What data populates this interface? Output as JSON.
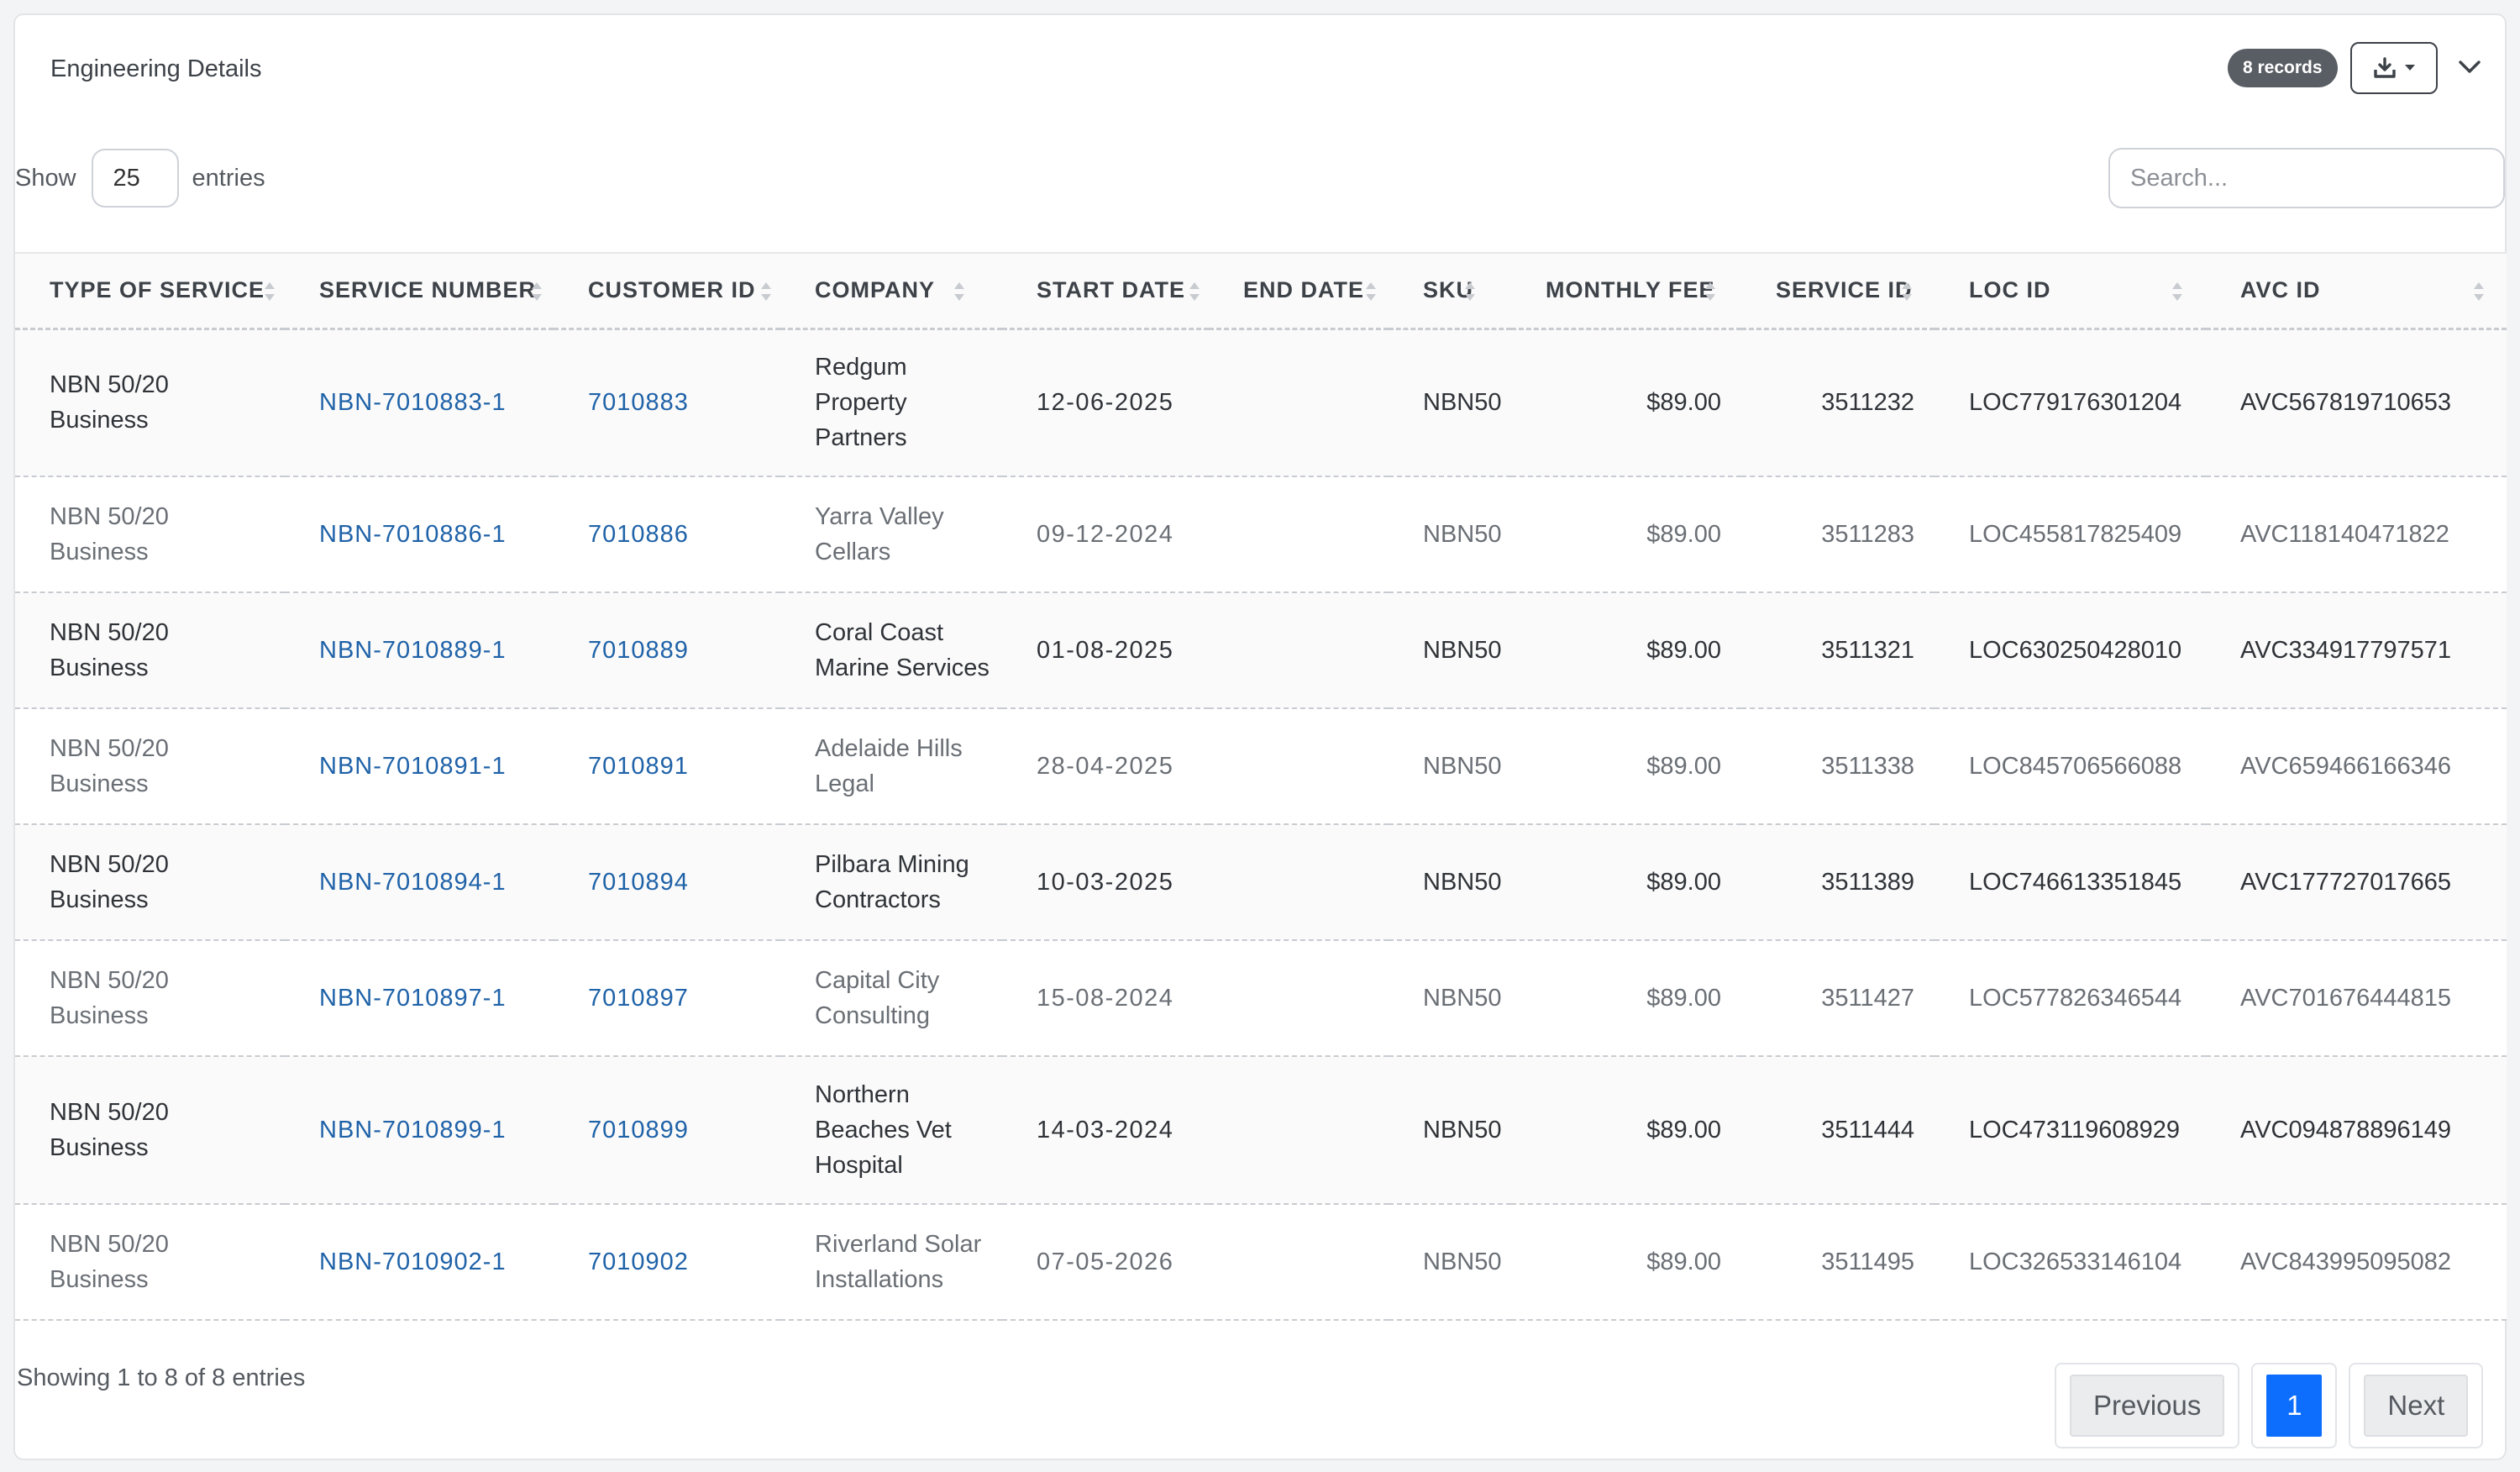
{
  "card": {
    "title": "Engineering Details",
    "records_badge": "8 records"
  },
  "controls": {
    "show_label": "Show",
    "entries_value": "25",
    "entries_label": "entries",
    "search_placeholder": "Search..."
  },
  "table": {
    "columns": [
      "TYPE OF SERVICE",
      "SERVICE NUMBER",
      "CUSTOMER ID",
      "COMPANY",
      "START DATE",
      "END DATE",
      "SKU",
      "MONTHLY FEE",
      "SERVICE ID",
      "LOC ID",
      "AVC ID"
    ],
    "rows": [
      {
        "type": [
          "NBN 50/20",
          "Business"
        ],
        "service_number": "NBN-7010883-1",
        "customer_id": "7010883",
        "company": [
          "Redgum",
          "Property",
          "Partners"
        ],
        "start_date": "12-06-2025",
        "end_date": "",
        "sku": "NBN50",
        "monthly_fee": "$89.00",
        "service_id": "3511232",
        "loc_id": "LOC779176301204",
        "avc_id": "AVC567819710653"
      },
      {
        "type": [
          "NBN 50/20",
          "Business"
        ],
        "service_number": "NBN-7010886-1",
        "customer_id": "7010886",
        "company": [
          "Yarra Valley",
          "Cellars"
        ],
        "start_date": "09-12-2024",
        "end_date": "",
        "sku": "NBN50",
        "monthly_fee": "$89.00",
        "service_id": "3511283",
        "loc_id": "LOC455817825409",
        "avc_id": "AVC118140471822"
      },
      {
        "type": [
          "NBN 50/20",
          "Business"
        ],
        "service_number": "NBN-7010889-1",
        "customer_id": "7010889",
        "company": [
          "Coral Coast",
          "Marine Services"
        ],
        "start_date": "01-08-2025",
        "end_date": "",
        "sku": "NBN50",
        "monthly_fee": "$89.00",
        "service_id": "3511321",
        "loc_id": "LOC630250428010",
        "avc_id": "AVC334917797571"
      },
      {
        "type": [
          "NBN 50/20",
          "Business"
        ],
        "service_number": "NBN-7010891-1",
        "customer_id": "7010891",
        "company": [
          "Adelaide Hills",
          "Legal"
        ],
        "start_date": "28-04-2025",
        "end_date": "",
        "sku": "NBN50",
        "monthly_fee": "$89.00",
        "service_id": "3511338",
        "loc_id": "LOC845706566088",
        "avc_id": "AVC659466166346"
      },
      {
        "type": [
          "NBN 50/20",
          "Business"
        ],
        "service_number": "NBN-7010894-1",
        "customer_id": "7010894",
        "company": [
          "Pilbara Mining",
          "Contractors"
        ],
        "start_date": "10-03-2025",
        "end_date": "",
        "sku": "NBN50",
        "monthly_fee": "$89.00",
        "service_id": "3511389",
        "loc_id": "LOC746613351845",
        "avc_id": "AVC177727017665"
      },
      {
        "type": [
          "NBN 50/20",
          "Business"
        ],
        "service_number": "NBN-7010897-1",
        "customer_id": "7010897",
        "company": [
          "Capital City",
          "Consulting"
        ],
        "start_date": "15-08-2024",
        "end_date": "",
        "sku": "NBN50",
        "monthly_fee": "$89.00",
        "service_id": "3511427",
        "loc_id": "LOC577826346544",
        "avc_id": "AVC701676444815"
      },
      {
        "type": [
          "NBN 50/20",
          "Business"
        ],
        "service_number": "NBN-7010899-1",
        "customer_id": "7010899",
        "company": [
          "Northern",
          "Beaches Vet",
          "Hospital"
        ],
        "start_date": "14-03-2024",
        "end_date": "",
        "sku": "NBN50",
        "monthly_fee": "$89.00",
        "service_id": "3511444",
        "loc_id": "LOC473119608929",
        "avc_id": "AVC094878896149"
      },
      {
        "type": [
          "NBN 50/20",
          "Business"
        ],
        "service_number": "NBN-7010902-1",
        "customer_id": "7010902",
        "company": [
          "Riverland Solar",
          "Installations"
        ],
        "start_date": "07-05-2026",
        "end_date": "",
        "sku": "NBN50",
        "monthly_fee": "$89.00",
        "service_id": "3511495",
        "loc_id": "LOC326533146104",
        "avc_id": "AVC843995095082"
      }
    ]
  },
  "footer": {
    "info": "Showing 1 to 8 of 8 entries",
    "previous_label": "Previous",
    "page_current": "1",
    "next_label": "Next"
  },
  "icons": {
    "download": "download-icon",
    "caret": "caret-down-icon",
    "collapse": "chevron-down-icon",
    "sort": "sort-icon"
  },
  "colors": {
    "link": "#1f62a8",
    "badge": "#595e64",
    "page_active": "#0d6efd"
  }
}
